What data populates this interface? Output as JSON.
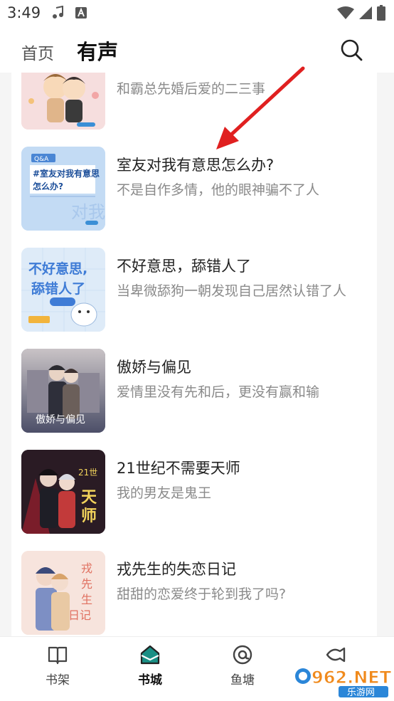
{
  "status_bar": {
    "time": "3:49",
    "left_icons": [
      "music-note-icon",
      "keyboard-a-icon"
    ],
    "right_icons": [
      "wifi-icon",
      "signal-icon",
      "battery-icon"
    ]
  },
  "header": {
    "tab_home": "首页",
    "tab_audio": "有声",
    "active_tab": "有声",
    "search_icon": "search-icon"
  },
  "books": [
    {
      "title": "",
      "desc": "和霸总先婚后爱的二三事",
      "cover_bg": "#f3d6d6"
    },
    {
      "title": "室友对我有意思怎么办?",
      "desc": "不是自作多情，他的眼神骗不了人",
      "cover_text": "室友对我有意思 怎么办?",
      "cover_bg": "#bcd6f2"
    },
    {
      "title": "不好意思，舔错人了",
      "desc": "当卑微舔狗一朝发现自己居然认错了人",
      "cover_text": "不好意思, 舔错人了",
      "cover_bg": "#dce9f8"
    },
    {
      "title": "傲娇与偏见",
      "desc": "爱情里没有先和后，更没有赢和输",
      "cover_text": "傲娇与偏见",
      "cover_bg": "#5a5f78"
    },
    {
      "title": "21世纪不需要天师",
      "desc": "我的男友是鬼王",
      "cover_text": "天师",
      "cover_bg": "#2b1c26"
    },
    {
      "title": "戎先生的失恋日记",
      "desc": "甜甜的恋爱终于轮到我了吗?",
      "cover_text": "戎先生的失恋日记",
      "cover_bg": "#f6e2dc"
    }
  ],
  "bottom_nav": {
    "items": [
      {
        "label": "书架",
        "icon": "book-icon"
      },
      {
        "label": "书城",
        "icon": "bookstore-icon"
      },
      {
        "label": "鱼塘",
        "icon": "at-icon"
      },
      {
        "label": "",
        "icon": "fish-icon"
      }
    ],
    "active": "书城",
    "accent_color": "#1a8f85"
  },
  "watermark": {
    "text": "962.NET",
    "subtext": "乐游网"
  },
  "annotation": {
    "arrow_color": "#e02020"
  }
}
